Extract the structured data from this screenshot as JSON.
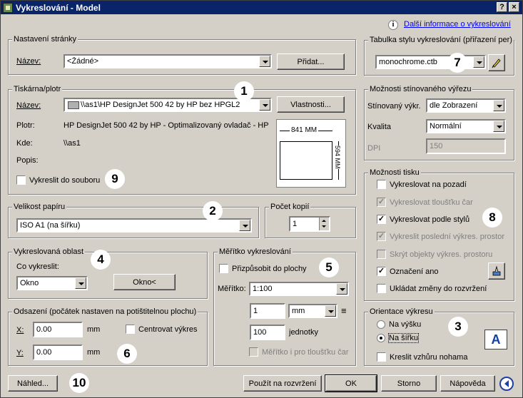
{
  "window": {
    "title": "Vykreslování - Model",
    "help_btn": "?",
    "close_btn": "×"
  },
  "info_link": "Další informace o vykreslování",
  "page_setup": {
    "legend": "Nastavení stránky",
    "name_label": "Název:",
    "name_value": "<Žádné>",
    "add_button": "Přidat..."
  },
  "printer": {
    "legend": "Tiskárna/plotr",
    "name_label": "Název:",
    "name_value": "\\\\as1\\HP DesignJet 500 42 by HP bez HPGL2",
    "properties_button": "Vlastnosti...",
    "plotter_label": "Plotr:",
    "plotter_value": "HP DesignJet 500 42 by HP - Optimalizovaný ovladač - HP",
    "where_label": "Kde:",
    "where_value": "\\\\as1",
    "desc_label": "Popis:",
    "plot_to_file": "Vykreslit do souboru",
    "preview_width": "841 MM",
    "preview_height": "594 MM"
  },
  "paper_size": {
    "legend": "Velikost papíru",
    "value": "ISO A1  (na šířku)"
  },
  "copies": {
    "legend": "Počet kopií",
    "value": "1"
  },
  "plot_area": {
    "legend": "Vykreslovaná oblast",
    "what_label": "Co vykreslit:",
    "what_value": "Okno",
    "window_button": "Okno<"
  },
  "scale": {
    "legend": "Měřítko vykreslování",
    "fit": "Přizpůsobit do plochy",
    "scale_label": "Měřítko:",
    "scale_value": "1:100",
    "num1": "1",
    "unit": "mm",
    "equals": "≡",
    "num2": "100",
    "unit2": "jednotky",
    "scale_lineweights": "Měřítko i pro tloušťku čar"
  },
  "offset": {
    "legend": "Odsazení (počátek nastaven na potištitelnou plochu)",
    "x_label": "X:",
    "x_value": "0.00",
    "x_unit": "mm",
    "y_label": "Y:",
    "y_value": "0.00",
    "y_unit": "mm",
    "center": "Centrovat výkres"
  },
  "style_table": {
    "legend": "Tabulka stylu vykreslování (přiřazení per)",
    "value": "monochrome.ctb"
  },
  "shaded": {
    "legend": "Možnosti stínovaného výřezu",
    "shade_label": "Stínovaný výkr.",
    "shade_value": "dle Zobrazení",
    "quality_label": "Kvalita",
    "quality_value": "Normální",
    "dpi_label": "DPI",
    "dpi_value": "150"
  },
  "options": {
    "legend": "Možnosti tisku",
    "items": [
      {
        "label": "Vykreslovat na pozadí",
        "checked": "",
        "disabled": false
      },
      {
        "label": "Vykreslovat tloušťku čar",
        "checked": "✓",
        "disabled": true
      },
      {
        "label": "Vykreslovat podle stylů",
        "checked": "✓",
        "disabled": false
      },
      {
        "label": "Vykreslit poslední výkres. prostor",
        "checked": "✓",
        "disabled": true
      },
      {
        "label": "Skrýt objekty výkres. prostoru",
        "checked": "",
        "disabled": true
      },
      {
        "label": "Označení ano",
        "checked": "✓",
        "disabled": false
      },
      {
        "label": "Ukládat změny do rozvržení",
        "checked": "",
        "disabled": false
      }
    ]
  },
  "orientation": {
    "legend": "Orientace výkresu",
    "portrait": "Na výšku",
    "landscape": "Na šířku",
    "upside_down": "Kreslit vzhůru nohama",
    "icon_letter": "A"
  },
  "buttons": {
    "preview": "Náhled...",
    "apply": "Použít na rozvržení",
    "ok": "OK",
    "cancel": "Storno",
    "help": "Nápověda"
  },
  "callouts": [
    "1",
    "2",
    "3",
    "4",
    "5",
    "6",
    "7",
    "8",
    "9",
    "10"
  ]
}
